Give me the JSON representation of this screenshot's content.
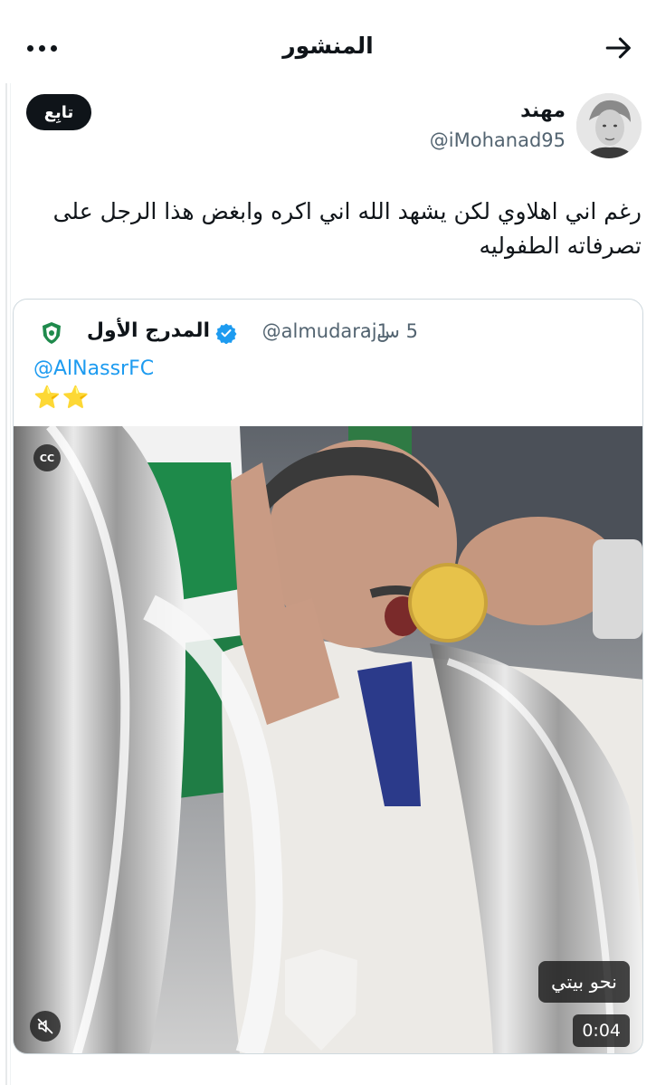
{
  "header": {
    "title": "المنشور",
    "back_icon": "arrow-right-icon",
    "more_icon": "more-horizontal-icon"
  },
  "post": {
    "author_name": "مهند",
    "author_handle": "@iMohanad95",
    "follow_label": "تابِع",
    "text": "رغم اني اهلاوي لكن يشهد الله اني اكره وابغض هذا الرجل على تصرفاته الطفوليه"
  },
  "quote": {
    "name": "المدرج الأول",
    "handle": "@almudaraj1",
    "time": "5 س ·",
    "mention": "@AlNassrFC",
    "stars": "⭐⭐",
    "verified_icon": "verified-badge-icon"
  },
  "video": {
    "cc_label": "CC",
    "caption_chip": "نحو بيتي",
    "duration": "0:04",
    "mute_icon": "speaker-muted-icon"
  },
  "colors": {
    "accent": "#1d9bf0",
    "text": "#0f1419",
    "secondary": "#536471",
    "border": "#cfd9de"
  }
}
